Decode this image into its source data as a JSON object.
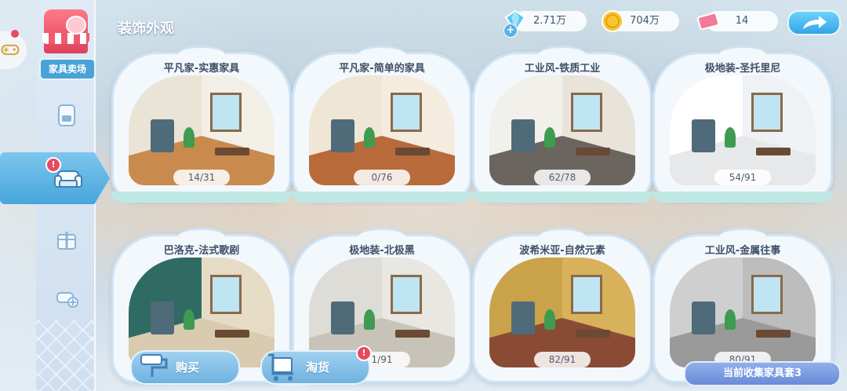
{
  "page": {
    "title": "装饰外观"
  },
  "currency": [
    {
      "name": "diamond",
      "value": "2.71万",
      "icon": "diamond-icon"
    },
    {
      "name": "coin",
      "value": "704万",
      "icon": "coin-icon"
    },
    {
      "name": "ticket",
      "value": "14",
      "icon": "ticket-icon"
    }
  ],
  "sidebar": {
    "store_label": "家具卖场",
    "tabs": [
      {
        "name": "cafe-tab",
        "icon": "coffee-machine-icon"
      },
      {
        "name": "furniture-tab",
        "icon": "sofa-icon",
        "selected": true,
        "badge": "!"
      },
      {
        "name": "gift-tab",
        "icon": "gift-box-icon"
      },
      {
        "name": "add-sofa-tab",
        "icon": "sofa-plus-icon"
      }
    ]
  },
  "cards": [
    {
      "title": "平凡家-实惠家具",
      "count": "14/31",
      "wall": "#e9e4d6",
      "wall2": "#f2efe6",
      "floor": "#c98a4e",
      "theme": "plain"
    },
    {
      "title": "平凡家-简单的家具",
      "count": "0/76",
      "wall": "#efe6d6",
      "wall2": "#f4ecde",
      "floor": "#b86a3a",
      "theme": "simple"
    },
    {
      "title": "工业风-铁质工业",
      "count": "62/78",
      "wall": "#f2f0ea",
      "wall2": "#e8e4da",
      "floor": "#6b6560",
      "theme": "iron"
    },
    {
      "title": "极地装-圣托里尼",
      "count": "54/91",
      "wall": "#ffffff",
      "wall2": "#eef2f4",
      "floor": "#e6e8ea",
      "theme": "santorini"
    },
    {
      "title": "巴洛克-法式歌剧",
      "count": "",
      "wall": "#2f6b63",
      "wall2": "#e6dcc6",
      "floor": "#d8cbb0",
      "theme": "baroque"
    },
    {
      "title": "极地装-北极黑",
      "count": "1/91",
      "wall": "#dedcd6",
      "wall2": "#e9e7e2",
      "floor": "#c8c3b8",
      "theme": "arctic"
    },
    {
      "title": "波希米亚-自然元素",
      "count": "82/91",
      "wall": "#c9a24a",
      "wall2": "#d8b25a",
      "floor": "#8a4b34",
      "theme": "boho"
    },
    {
      "title": "工业风-金属往事",
      "count": "80/91",
      "wall": "#cfcfcf",
      "wall2": "#bdbdbd",
      "floor": "#9a9a9a",
      "theme": "metal"
    }
  ],
  "actions": {
    "buy": "购买",
    "shop": "淘货",
    "shop_badge": "!"
  },
  "collection": {
    "label": "当前收集家具套3"
  }
}
